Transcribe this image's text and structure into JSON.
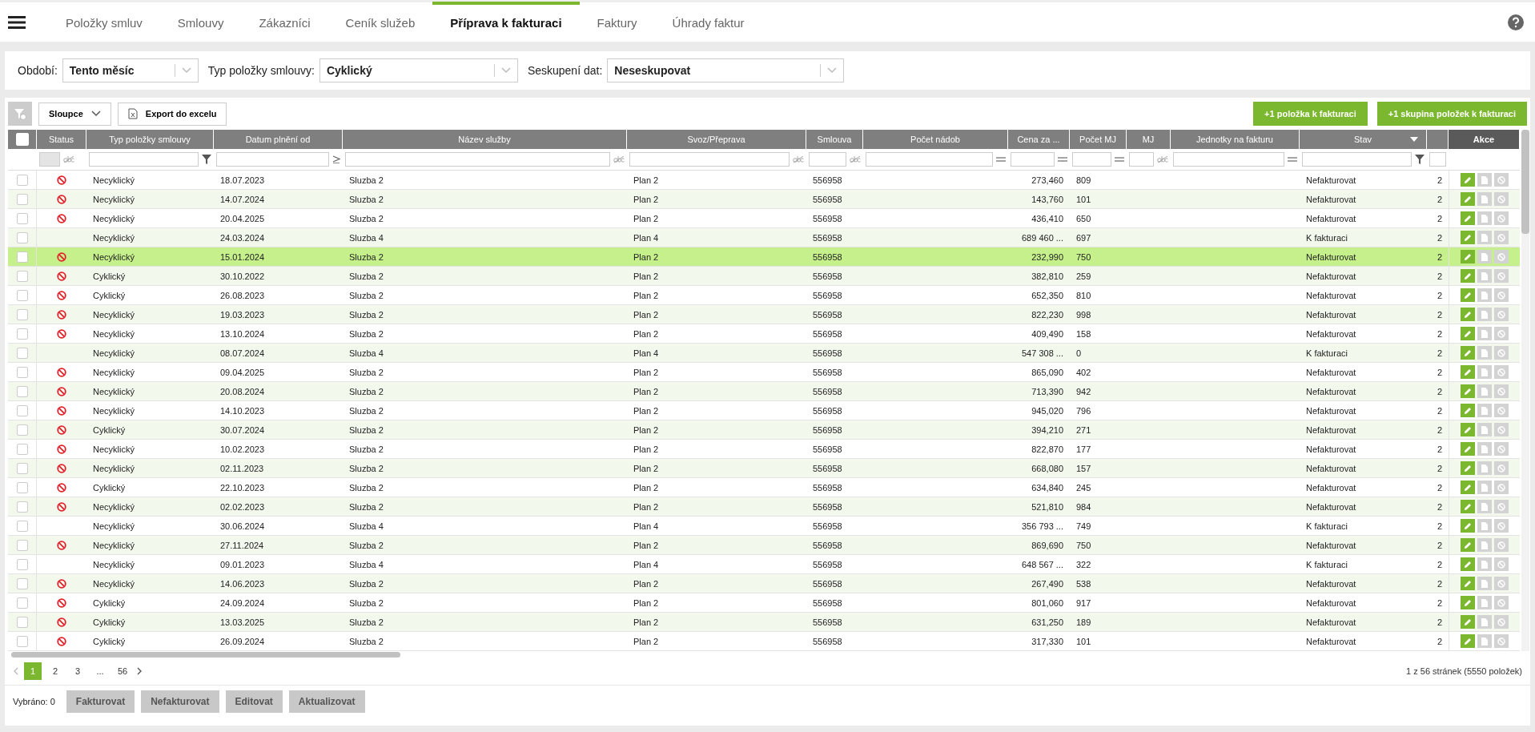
{
  "nav": {
    "tabs": [
      {
        "label": "Položky smluv",
        "selected": false
      },
      {
        "label": "Smlouvy",
        "selected": false
      },
      {
        "label": "Zákazníci",
        "selected": false
      },
      {
        "label": "Ceník služeb",
        "selected": false
      },
      {
        "label": "Příprava k fakturaci",
        "selected": true
      },
      {
        "label": "Faktury",
        "selected": false
      },
      {
        "label": "Úhrady faktur",
        "selected": false
      }
    ]
  },
  "filters": [
    {
      "label": "Období:",
      "value": "Tento měsíc"
    },
    {
      "label": "Typ položky smlouvy:",
      "value": "Cyklický"
    },
    {
      "label": "Seskupení dat:",
      "value": "Neseskupovat"
    }
  ],
  "toolbar": {
    "columns_button": "Sloupce",
    "export_button": "Export do excelu",
    "add_buttons": [
      "+1 položka k fakturaci",
      "+1 skupina položek k fakturaci"
    ]
  },
  "table": {
    "select_all_checked": false,
    "columns": [
      {
        "kind": "checkbox"
      },
      {
        "kind": "status",
        "label": "Status"
      },
      {
        "kind": "data",
        "label": "Typ položky smlouvy"
      },
      {
        "kind": "data",
        "label": "Datum plnění od"
      },
      {
        "kind": "data",
        "label": "Název služby"
      },
      {
        "kind": "data",
        "label": "Svoz/Přeprava"
      },
      {
        "kind": "data",
        "label": "Smlouva"
      },
      {
        "kind": "data",
        "label": "Počet nádob"
      },
      {
        "kind": "data",
        "label": "Cena za ..."
      },
      {
        "kind": "data",
        "label": "Počet MJ"
      },
      {
        "kind": "data",
        "label": "MJ"
      },
      {
        "kind": "data",
        "label": "Jednotky na fakturu"
      },
      {
        "kind": "data",
        "label": "Stav"
      },
      {
        "kind": "data"
      },
      {
        "kind": "actions",
        "label": "Akce"
      }
    ],
    "rows": [
      {
        "selected": false,
        "blocked": true,
        "cells": [
          "",
          "",
          "Necyklický",
          "18.07.2023",
          "Sluzba 2",
          "Plan 2",
          "556958",
          "",
          "273,460",
          "809",
          "",
          "",
          "Nefakturovat",
          "2",
          ""
        ]
      },
      {
        "selected": false,
        "blocked": true,
        "cells": [
          "",
          "",
          "Necyklický",
          "14.07.2024",
          "Sluzba 2",
          "Plan 2",
          "556958",
          "",
          "143,760",
          "101",
          "",
          "",
          "Nefakturovat",
          "2",
          ""
        ]
      },
      {
        "selected": false,
        "blocked": true,
        "cells": [
          "",
          "",
          "Necyklický",
          "20.04.2025",
          "Sluzba 2",
          "Plan 2",
          "556958",
          "",
          "436,410",
          "650",
          "",
          "",
          "Nefakturovat",
          "2",
          ""
        ]
      },
      {
        "selected": false,
        "blocked": false,
        "cells": [
          "",
          "",
          "Necyklický",
          "24.03.2024",
          "Sluzba 4",
          "Plan 4",
          "556958",
          "",
          "689 460 ...",
          "697",
          "",
          "",
          "K fakturaci",
          "2",
          ""
        ]
      },
      {
        "selected": true,
        "blocked": true,
        "cells": [
          "",
          "",
          "Necyklický",
          "15.01.2024",
          "Sluzba 2",
          "Plan 2",
          "556958",
          "",
          "232,990",
          "750",
          "",
          "",
          "Nefakturovat",
          "2",
          ""
        ]
      },
      {
        "selected": false,
        "blocked": true,
        "cells": [
          "",
          "",
          "Cyklický",
          "30.10.2022",
          "Sluzba 2",
          "Plan 2",
          "556958",
          "",
          "382,810",
          "259",
          "",
          "",
          "Nefakturovat",
          "2",
          ""
        ]
      },
      {
        "selected": false,
        "blocked": true,
        "cells": [
          "",
          "",
          "Cyklický",
          "26.08.2023",
          "Sluzba 2",
          "Plan 2",
          "556958",
          "",
          "652,350",
          "810",
          "",
          "",
          "Nefakturovat",
          "2",
          ""
        ]
      },
      {
        "selected": false,
        "blocked": true,
        "cells": [
          "",
          "",
          "Necyklický",
          "19.03.2023",
          "Sluzba 2",
          "Plan 2",
          "556958",
          "",
          "822,230",
          "998",
          "",
          "",
          "Nefakturovat",
          "2",
          ""
        ]
      },
      {
        "selected": false,
        "blocked": true,
        "cells": [
          "",
          "",
          "Necyklický",
          "13.10.2024",
          "Sluzba 2",
          "Plan 2",
          "556958",
          "",
          "409,490",
          "158",
          "",
          "",
          "Nefakturovat",
          "2",
          ""
        ]
      },
      {
        "selected": false,
        "blocked": false,
        "cells": [
          "",
          "",
          "Necyklický",
          "08.07.2024",
          "Sluzba 4",
          "Plan 4",
          "556958",
          "",
          "547 308 ...",
          "0",
          "",
          "",
          "K fakturaci",
          "2",
          ""
        ]
      },
      {
        "selected": false,
        "blocked": true,
        "cells": [
          "",
          "",
          "Necyklický",
          "09.04.2025",
          "Sluzba 2",
          "Plan 2",
          "556958",
          "",
          "865,090",
          "402",
          "",
          "",
          "Nefakturovat",
          "2",
          ""
        ]
      },
      {
        "selected": false,
        "blocked": true,
        "cells": [
          "",
          "",
          "Necyklický",
          "20.08.2024",
          "Sluzba 2",
          "Plan 2",
          "556958",
          "",
          "713,390",
          "942",
          "",
          "",
          "Nefakturovat",
          "2",
          ""
        ]
      },
      {
        "selected": false,
        "blocked": true,
        "cells": [
          "",
          "",
          "Necyklický",
          "14.10.2023",
          "Sluzba 2",
          "Plan 2",
          "556958",
          "",
          "945,020",
          "796",
          "",
          "",
          "Nefakturovat",
          "2",
          ""
        ]
      },
      {
        "selected": false,
        "blocked": true,
        "cells": [
          "",
          "",
          "Cyklický",
          "30.07.2024",
          "Sluzba 2",
          "Plan 2",
          "556958",
          "",
          "394,210",
          "271",
          "",
          "",
          "Nefakturovat",
          "2",
          ""
        ]
      },
      {
        "selected": false,
        "blocked": true,
        "cells": [
          "",
          "",
          "Necyklický",
          "10.02.2023",
          "Sluzba 2",
          "Plan 2",
          "556958",
          "",
          "822,870",
          "177",
          "",
          "",
          "Nefakturovat",
          "2",
          ""
        ]
      },
      {
        "selected": false,
        "blocked": true,
        "cells": [
          "",
          "",
          "Necyklický",
          "02.11.2023",
          "Sluzba 2",
          "Plan 2",
          "556958",
          "",
          "668,080",
          "157",
          "",
          "",
          "Nefakturovat",
          "2",
          ""
        ]
      },
      {
        "selected": false,
        "blocked": true,
        "cells": [
          "",
          "",
          "Cyklický",
          "22.10.2023",
          "Sluzba 2",
          "Plan 2",
          "556958",
          "",
          "634,840",
          "245",
          "",
          "",
          "Nefakturovat",
          "2",
          ""
        ]
      },
      {
        "selected": false,
        "blocked": true,
        "cells": [
          "",
          "",
          "Necyklický",
          "02.02.2023",
          "Sluzba 2",
          "Plan 2",
          "556958",
          "",
          "521,810",
          "984",
          "",
          "",
          "Nefakturovat",
          "2",
          ""
        ]
      },
      {
        "selected": false,
        "blocked": false,
        "cells": [
          "",
          "",
          "Necyklický",
          "30.06.2024",
          "Sluzba 4",
          "Plan 4",
          "556958",
          "",
          "356 793 ...",
          "749",
          "",
          "",
          "K fakturaci",
          "2",
          ""
        ]
      },
      {
        "selected": false,
        "blocked": true,
        "cells": [
          "",
          "",
          "Necyklický",
          "27.11.2024",
          "Sluzba 2",
          "Plan 2",
          "556958",
          "",
          "869,690",
          "750",
          "",
          "",
          "Nefakturovat",
          "2",
          ""
        ]
      },
      {
        "selected": false,
        "blocked": false,
        "cells": [
          "",
          "",
          "Necyklický",
          "09.01.2023",
          "Sluzba 4",
          "Plan 4",
          "556958",
          "",
          "648 567 ...",
          "322",
          "",
          "",
          "K fakturaci",
          "2",
          ""
        ]
      },
      {
        "selected": false,
        "blocked": true,
        "cells": [
          "",
          "",
          "Necyklický",
          "14.06.2023",
          "Sluzba 2",
          "Plan 2",
          "556958",
          "",
          "267,490",
          "538",
          "",
          "",
          "Nefakturovat",
          "2",
          ""
        ]
      },
      {
        "selected": false,
        "blocked": true,
        "cells": [
          "",
          "",
          "Cyklický",
          "24.09.2024",
          "Sluzba 2",
          "Plan 2",
          "556958",
          "",
          "801,060",
          "917",
          "",
          "",
          "Nefakturovat",
          "2",
          ""
        ]
      },
      {
        "selected": false,
        "blocked": true,
        "cells": [
          "",
          "",
          "Cyklický",
          "13.03.2025",
          "Sluzba 2",
          "Plan 2",
          "556958",
          "",
          "631,250",
          "189",
          "",
          "",
          "Nefakturovat",
          "2",
          ""
        ]
      },
      {
        "selected": false,
        "blocked": true,
        "cells": [
          "",
          "",
          "Cyklický",
          "26.09.2024",
          "Sluzba 2",
          "Plan 2",
          "556958",
          "",
          "317,330",
          "101",
          "",
          "",
          "Nefakturovat",
          "2",
          ""
        ]
      }
    ]
  },
  "pagination": {
    "pages": [
      {
        "label": "1",
        "selected": true
      },
      {
        "label": "2",
        "selected": false
      },
      {
        "label": "3",
        "selected": false
      },
      {
        "label": "...",
        "selected": false
      },
      {
        "label": "56",
        "selected": false
      }
    ],
    "summary": "1 z 56 stránek (5550 položek)"
  },
  "footer": {
    "selected_count": "Vybráno: 0",
    "buttons": [
      {
        "label": "Fakturovat",
        "disabled": true
      },
      {
        "label": "Nefakturovat",
        "disabled": true
      },
      {
        "label": "Editovat",
        "disabled": true
      },
      {
        "label": "Aktualizovat",
        "disabled": true
      }
    ]
  }
}
